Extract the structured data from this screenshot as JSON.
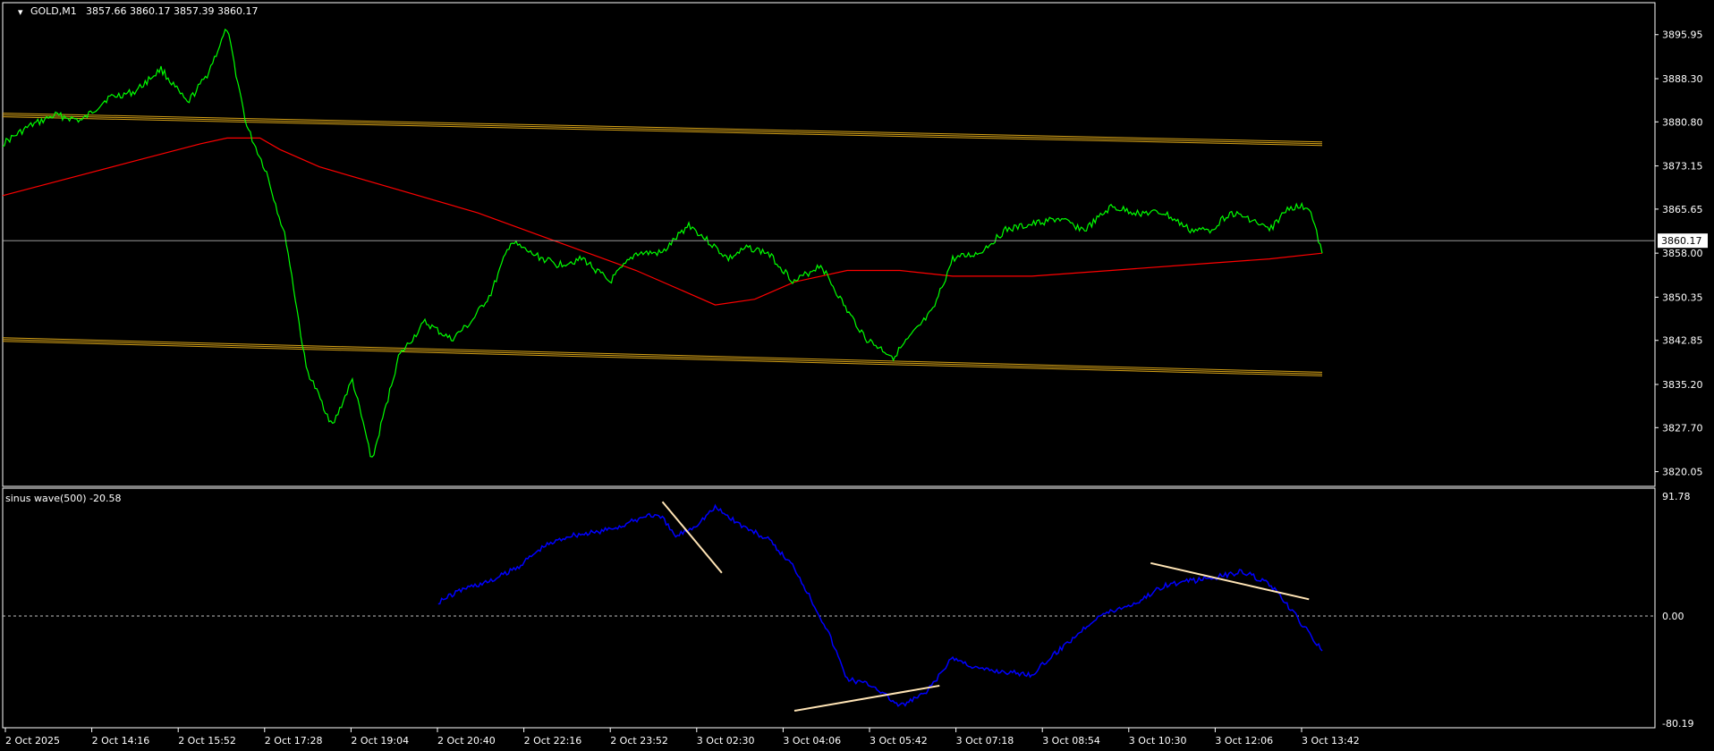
{
  "header": {
    "symbol": "GOLD,M1",
    "ohlc": "3857.66 3860.17 3857.39 3860.17"
  },
  "indicator": {
    "label": "sinus wave(500) -20.58"
  },
  "colors": {
    "background": "#000000",
    "price": "#00ff00",
    "ma": "#ff0000",
    "channel": "#d4a017",
    "indicator": "#0000ff",
    "trendline": "#ffe4b5",
    "axis": "#ffffff"
  },
  "chart_data": [
    {
      "type": "line",
      "name": "price-panel",
      "title": "GOLD,M1",
      "ylim": [
        3817.5,
        3901.5
      ],
      "y_ticks": [
        "3895.95",
        "3888.30",
        "3880.80",
        "3873.15",
        "3865.65",
        "3858.00",
        "3850.35",
        "3842.85",
        "3835.20",
        "3827.70",
        "3820.05"
      ],
      "y_tick_values": [
        3895.95,
        3888.3,
        3880.8,
        3873.15,
        3865.65,
        3858.0,
        3850.35,
        3842.85,
        3835.2,
        3827.7,
        3820.05
      ],
      "current_price": "3860.17",
      "current_value": 3860.17,
      "x_ticks": [
        "2 Oct 2025",
        "2 Oct 14:16",
        "2 Oct 15:52",
        "2 Oct 17:28",
        "2 Oct 19:04",
        "2 Oct 20:40",
        "2 Oct 22:16",
        "2 Oct 23:52",
        "3 Oct 02:30",
        "3 Oct 04:06",
        "3 Oct 05:42",
        "3 Oct 07:18",
        "3 Oct 08:54",
        "3 Oct 10:30",
        "3 Oct 12:06",
        "3 Oct 13:42"
      ],
      "series": [
        {
          "role": "close",
          "x": [
            0,
            0.02,
            0.04,
            0.06,
            0.08,
            0.1,
            0.12,
            0.14,
            0.155,
            0.17,
            0.185,
            0.2,
            0.215,
            0.23,
            0.25,
            0.265,
            0.28,
            0.3,
            0.32,
            0.34,
            0.355,
            0.37,
            0.385,
            0.4,
            0.42,
            0.44,
            0.46,
            0.48,
            0.5,
            0.52,
            0.535,
            0.55,
            0.565,
            0.58,
            0.6,
            0.62,
            0.64,
            0.655,
            0.675,
            0.69,
            0.705,
            0.72,
            0.74,
            0.76,
            0.78,
            0.8,
            0.82,
            0.84,
            0.86,
            0.88,
            0.9,
            0.915,
            0.93,
            0.945,
            0.96,
            0.975,
            0.99,
            1.0
          ],
          "y": [
            3877,
            3880,
            3882,
            3881,
            3885,
            3886,
            3890,
            3884,
            3889,
            3897,
            3880,
            3872,
            3860,
            3838,
            3828,
            3836,
            3822,
            3840,
            3846,
            3843,
            3846,
            3851,
            3860,
            3858,
            3856,
            3857,
            3853,
            3858,
            3858,
            3863,
            3860,
            3857,
            3859,
            3858,
            3853,
            3856,
            3848,
            3843,
            3840,
            3844,
            3848,
            3857,
            3858,
            3862,
            3863,
            3864,
            3862,
            3866,
            3865,
            3865,
            3862,
            3862,
            3865,
            3864,
            3862,
            3866,
            3866,
            3858
          ],
          "lw": 1.5
        },
        {
          "role": "ma",
          "x": [
            0,
            0.05,
            0.1,
            0.15,
            0.17,
            0.195,
            0.21,
            0.24,
            0.3,
            0.36,
            0.42,
            0.48,
            0.52,
            0.54,
            0.57,
            0.6,
            0.64,
            0.68,
            0.72,
            0.78,
            0.84,
            0.9,
            0.96,
            1.0
          ],
          "y": [
            3868,
            3871,
            3874,
            3877,
            3878,
            3878,
            3876,
            3873,
            3869,
            3865,
            3860,
            3855,
            3851,
            3849,
            3850,
            3853,
            3855,
            3855,
            3854,
            3854,
            3855,
            3856,
            3857,
            3858
          ]
        },
        {
          "role": "channel-top",
          "x": [
            0,
            1
          ],
          "y": [
            3882,
            3877
          ]
        },
        {
          "role": "channel-bottom",
          "x": [
            0,
            1
          ],
          "y": [
            3843,
            3837
          ]
        }
      ]
    },
    {
      "type": "line",
      "name": "indicator-panel",
      "title": "sinus wave(500) -20.58",
      "ylim": [
        -80.19,
        91.78
      ],
      "y_ticks": [
        "91.78",
        "0.00",
        "-80.19"
      ],
      "y_tick_values": [
        91.78,
        0,
        -80.19
      ],
      "zero_line": true,
      "series": [
        {
          "role": "sinus",
          "x": [
            0.33,
            0.35,
            0.37,
            0.39,
            0.41,
            0.43,
            0.45,
            0.47,
            0.49,
            0.5,
            0.51,
            0.525,
            0.54,
            0.56,
            0.58,
            0.6,
            0.625,
            0.64,
            0.66,
            0.68,
            0.7,
            0.72,
            0.74,
            0.76,
            0.78,
            0.8,
            0.83,
            0.86,
            0.88,
            0.9,
            0.92,
            0.94,
            0.96,
            0.98,
            1.0
          ],
          "y": [
            10,
            20,
            25,
            35,
            50,
            58,
            60,
            65,
            73,
            70,
            57,
            65,
            78,
            65,
            55,
            35,
            -10,
            -45,
            -50,
            -65,
            -55,
            -30,
            -38,
            -40,
            -42,
            -25,
            0,
            10,
            22,
            25,
            28,
            32,
            23,
            0,
            -25
          ],
          "lw": 1.5
        },
        {
          "role": "trendline-1",
          "x": [
            0.5,
            0.545
          ],
          "y": [
            82,
            31
          ]
        },
        {
          "role": "trendline-2",
          "x": [
            0.6,
            0.71
          ],
          "y": [
            -68,
            -50
          ]
        },
        {
          "role": "trendline-3",
          "x": [
            0.87,
            0.99
          ],
          "y": [
            38,
            12
          ]
        }
      ]
    }
  ]
}
